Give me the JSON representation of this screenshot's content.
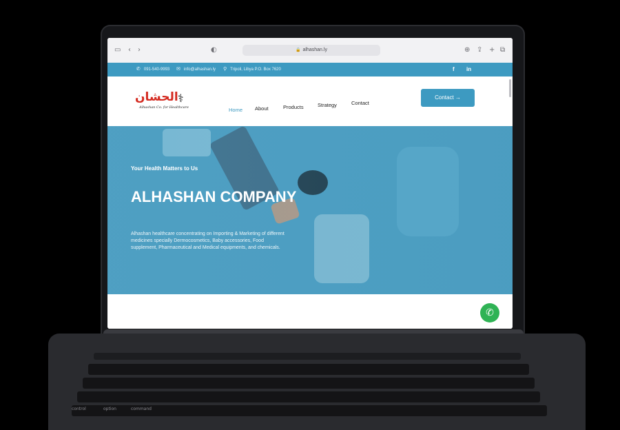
{
  "browser": {
    "url": "alhashan.ly",
    "icons": [
      "sidebar-icon",
      "back-icon",
      "forward-icon",
      "shield-icon",
      "download-icon",
      "share-icon",
      "new-tab-icon",
      "tabs-icon"
    ]
  },
  "topbar": {
    "phone": "091-540-9993",
    "email": "info@alhashan.ly",
    "address": "Tripoli, Libya P.O. Box 7620",
    "social": [
      "f",
      "in"
    ]
  },
  "logo": {
    "arabic": "الحشان",
    "tagline": "Alhashan Co. for Healthcare"
  },
  "nav": {
    "items": [
      {
        "label": "Home",
        "active": true
      },
      {
        "label": "About",
        "active": false
      },
      {
        "label": "Products",
        "active": false
      },
      {
        "label": "Strategy",
        "active": false
      },
      {
        "label": "Contact",
        "active": false
      }
    ],
    "contact_button": "Contact →"
  },
  "hero": {
    "tagline": "Your Health Matters to Us",
    "title": "ALHASHAN COMPANY",
    "description": "Alhashan healthcare concentrating on Importing & Marketing of different medicines specially Dermocosmetics, Baby accessories, Food supplement, Pharmaceutical and Medical equipments, and chemicals."
  },
  "colors": {
    "brand_blue": "#3d9ac1",
    "logo_red": "#d42a20",
    "whatsapp_green": "#2fb355"
  },
  "keyboard": {
    "labels": [
      "control",
      "option",
      "command"
    ]
  }
}
